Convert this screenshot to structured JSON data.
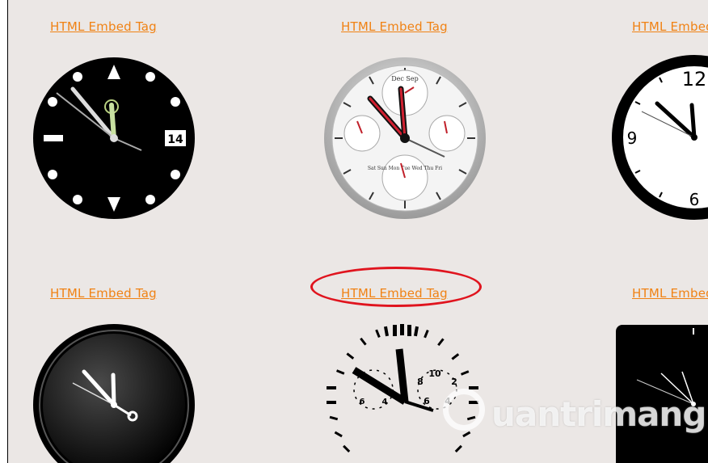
{
  "gallery": {
    "row1": [
      {
        "link": "HTML Embed Tag",
        "style": "diver-watch",
        "date": "14"
      },
      {
        "link": "HTML Embed Tag",
        "style": "chronograph",
        "subdial_top": "Dec Sep",
        "subdial_bottom": "Sat Sun Mon Tue Wed Thu Fri"
      },
      {
        "link": "HTML Embed Tag",
        "style": "classic-white",
        "numbers": [
          "12",
          "9",
          "6"
        ]
      }
    ],
    "row2": [
      {
        "link": "HTML Embed Tag",
        "style": "black-round"
      },
      {
        "link": "HTML Embed Tag",
        "style": "skeleton-24h",
        "numbers": [
          "10",
          "2",
          "8",
          "4",
          "6"
        ]
      },
      {
        "link": "HTML Embed Tag",
        "style": "black-square"
      }
    ]
  },
  "annotation": {
    "highlight_color": "#e0141e",
    "target": "row2 column2 link"
  },
  "watermark": {
    "text": "uantrimang"
  },
  "colors": {
    "link": "#f08214",
    "background": "#ebe7e5"
  }
}
